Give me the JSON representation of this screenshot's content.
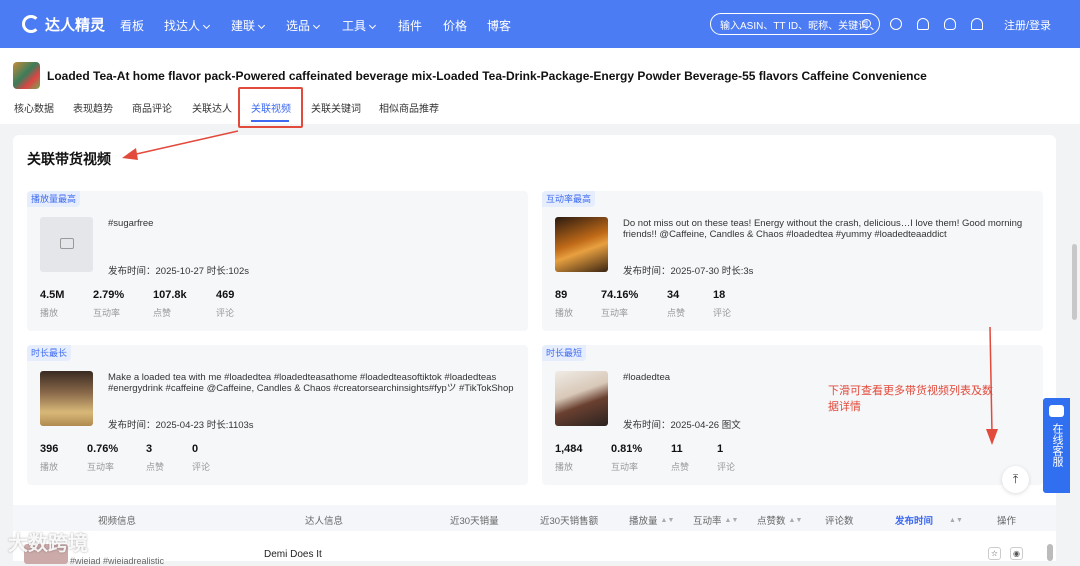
{
  "brand": {
    "name": "达人精灵"
  },
  "nav": [
    {
      "label": "看板",
      "dropdown": false
    },
    {
      "label": "找达人",
      "dropdown": true
    },
    {
      "label": "建联",
      "dropdown": true
    },
    {
      "label": "选品",
      "dropdown": true
    },
    {
      "label": "工具",
      "dropdown": true
    },
    {
      "label": "插件",
      "dropdown": false
    },
    {
      "label": "价格",
      "dropdown": false
    },
    {
      "label": "博客",
      "dropdown": false
    }
  ],
  "search": {
    "placeholder": "输入ASIN、TT ID、昵称、关键词"
  },
  "auth": {
    "label": "注册/登录"
  },
  "product": {
    "title": "Loaded Tea-At home flavor pack-Powered caffeinated beverage mix-Loaded Tea-Drink-Package-Energy Powder Beverage-55 flavors Caffeine Convenience"
  },
  "tabs": [
    "核心数据",
    "表现趋势",
    "商品评论",
    "关联达人",
    "关联视频",
    "关联关键词",
    "相似商品推荐"
  ],
  "active_tab": "关联视频",
  "section": {
    "title": "关联带货视频"
  },
  "video_cards": [
    {
      "tag": "播放量最高",
      "text": "#sugarfree",
      "meta": "发布时间：2025-10-27  时长:102s",
      "stats": [
        {
          "value": "4.5M",
          "label": "播放"
        },
        {
          "value": "2.79%",
          "label": "互动率"
        },
        {
          "value": "107.8k",
          "label": "点赞"
        },
        {
          "value": "469",
          "label": "评论"
        }
      ]
    },
    {
      "tag": "互动率最高",
      "text": "Do not miss out on these teas! Energy without the crash, delicious…I love them! Good morning friends!! @Caffeine, Candles & Chaos #loadedtea #yummy #loadedteaaddict",
      "meta": "发布时间：2025-07-30  时长:3s",
      "stats": [
        {
          "value": "89",
          "label": "播放"
        },
        {
          "value": "74.16%",
          "label": "互动率"
        },
        {
          "value": "34",
          "label": "点赞"
        },
        {
          "value": "18",
          "label": "评论"
        }
      ]
    },
    {
      "tag": "时长最长",
      "text": "Make a loaded tea with me #loadedtea #loadedteasathome #loadedteasoftiktok #loadedteas #energydrink #caffeine @Caffeine, Candles & Chaos #creatorsearchinsights#fypツ #TikTokShop",
      "meta": "发布时间：2025-04-23  时长:1103s",
      "stats": [
        {
          "value": "396",
          "label": "播放"
        },
        {
          "value": "0.76%",
          "label": "互动率"
        },
        {
          "value": "3",
          "label": "点赞"
        },
        {
          "value": "0",
          "label": "评论"
        }
      ]
    },
    {
      "tag": "时长最短",
      "text": "#loadedtea",
      "meta": "发布时间：2025-04-26  图文",
      "stats": [
        {
          "value": "1,484",
          "label": "播放"
        },
        {
          "value": "0.81%",
          "label": "互动率"
        },
        {
          "value": "11",
          "label": "点赞"
        },
        {
          "value": "1",
          "label": "评论"
        }
      ]
    }
  ],
  "annotation": "下滑可查看更多带货视频列表及数据详情",
  "table": {
    "columns": [
      "视频信息",
      "达人信息",
      "近30天销量",
      "近30天销售额",
      "播放量",
      "互动率",
      "点赞数",
      "评论数",
      "发布时间",
      "操作"
    ],
    "rows": [
      {
        "video_tags": "#wieiad #wieiadrealistic",
        "creator": "Demi Does It"
      }
    ]
  },
  "side_service": {
    "label": "在线客服"
  },
  "watermark": "大数跨境",
  "colors": {
    "primary": "#4c7cf3",
    "accent": "#3d6af0",
    "annotation": "#e24a3b"
  }
}
